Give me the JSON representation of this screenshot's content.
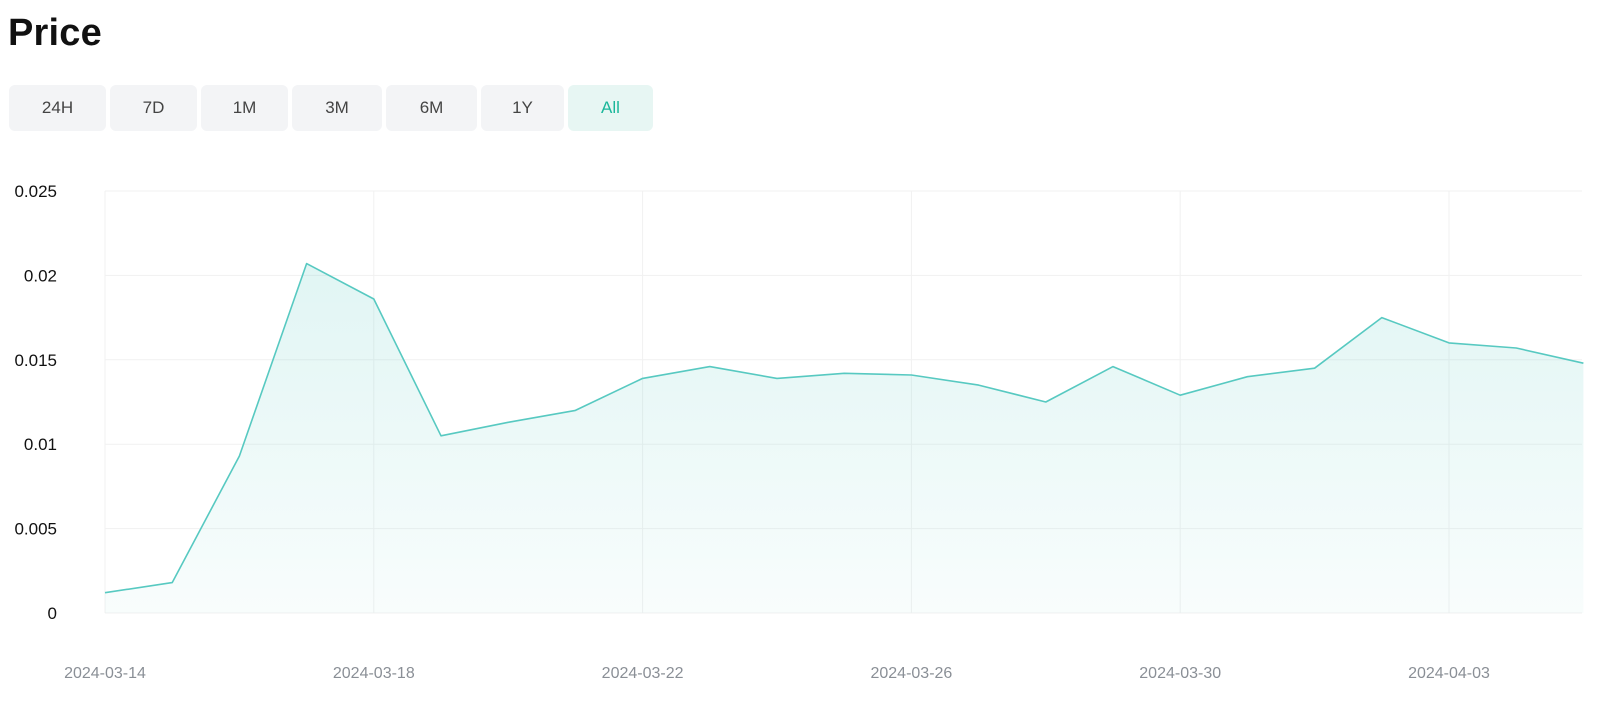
{
  "header": {
    "title": "Price"
  },
  "range_tabs": [
    {
      "label": "24H",
      "active": false
    },
    {
      "label": "7D",
      "active": false
    },
    {
      "label": "1M",
      "active": false
    },
    {
      "label": "3M",
      "active": false
    },
    {
      "label": "6M",
      "active": false
    },
    {
      "label": "1Y",
      "active": false
    },
    {
      "label": "All",
      "active": true
    }
  ],
  "colors": {
    "line": "#57c9c1",
    "fill": "#e2f5f2",
    "active_tab_text": "#1cb79b",
    "active_tab_bg": "#e7f6f3",
    "tab_bg": "#f3f4f6",
    "grid": "#f1f1f1"
  },
  "chart_data": {
    "type": "area",
    "title": "",
    "xlabel": "",
    "ylabel": "",
    "ylim": [
      0,
      0.025
    ],
    "y_ticks": [
      "0",
      "0.005",
      "0.01",
      "0.015",
      "0.02",
      "0.025"
    ],
    "x_ticks": [
      "2024-03-14",
      "2024-03-18",
      "2024-03-22",
      "2024-03-26",
      "2024-03-30",
      "2024-04-03"
    ],
    "grid": true,
    "legend": "none",
    "series": [
      {
        "x": [
          "2024-03-14",
          "2024-03-15",
          "2024-03-16",
          "2024-03-17",
          "2024-03-18",
          "2024-03-19",
          "2024-03-20",
          "2024-03-21",
          "2024-03-22",
          "2024-03-23",
          "2024-03-24",
          "2024-03-25",
          "2024-03-26",
          "2024-03-27",
          "2024-03-28",
          "2024-03-29",
          "2024-03-30",
          "2024-03-31",
          "2024-04-01",
          "2024-04-02",
          "2024-04-03",
          "2024-04-04",
          "2024-04-05"
        ],
        "values": [
          0.0012,
          0.0018,
          0.0093,
          0.0207,
          0.0186,
          0.0105,
          0.0113,
          0.012,
          0.0139,
          0.0146,
          0.0139,
          0.0142,
          0.0141,
          0.0135,
          0.0125,
          0.0146,
          0.0129,
          0.014,
          0.0145,
          0.0175,
          0.016,
          0.0157,
          0.0148
        ]
      }
    ]
  }
}
